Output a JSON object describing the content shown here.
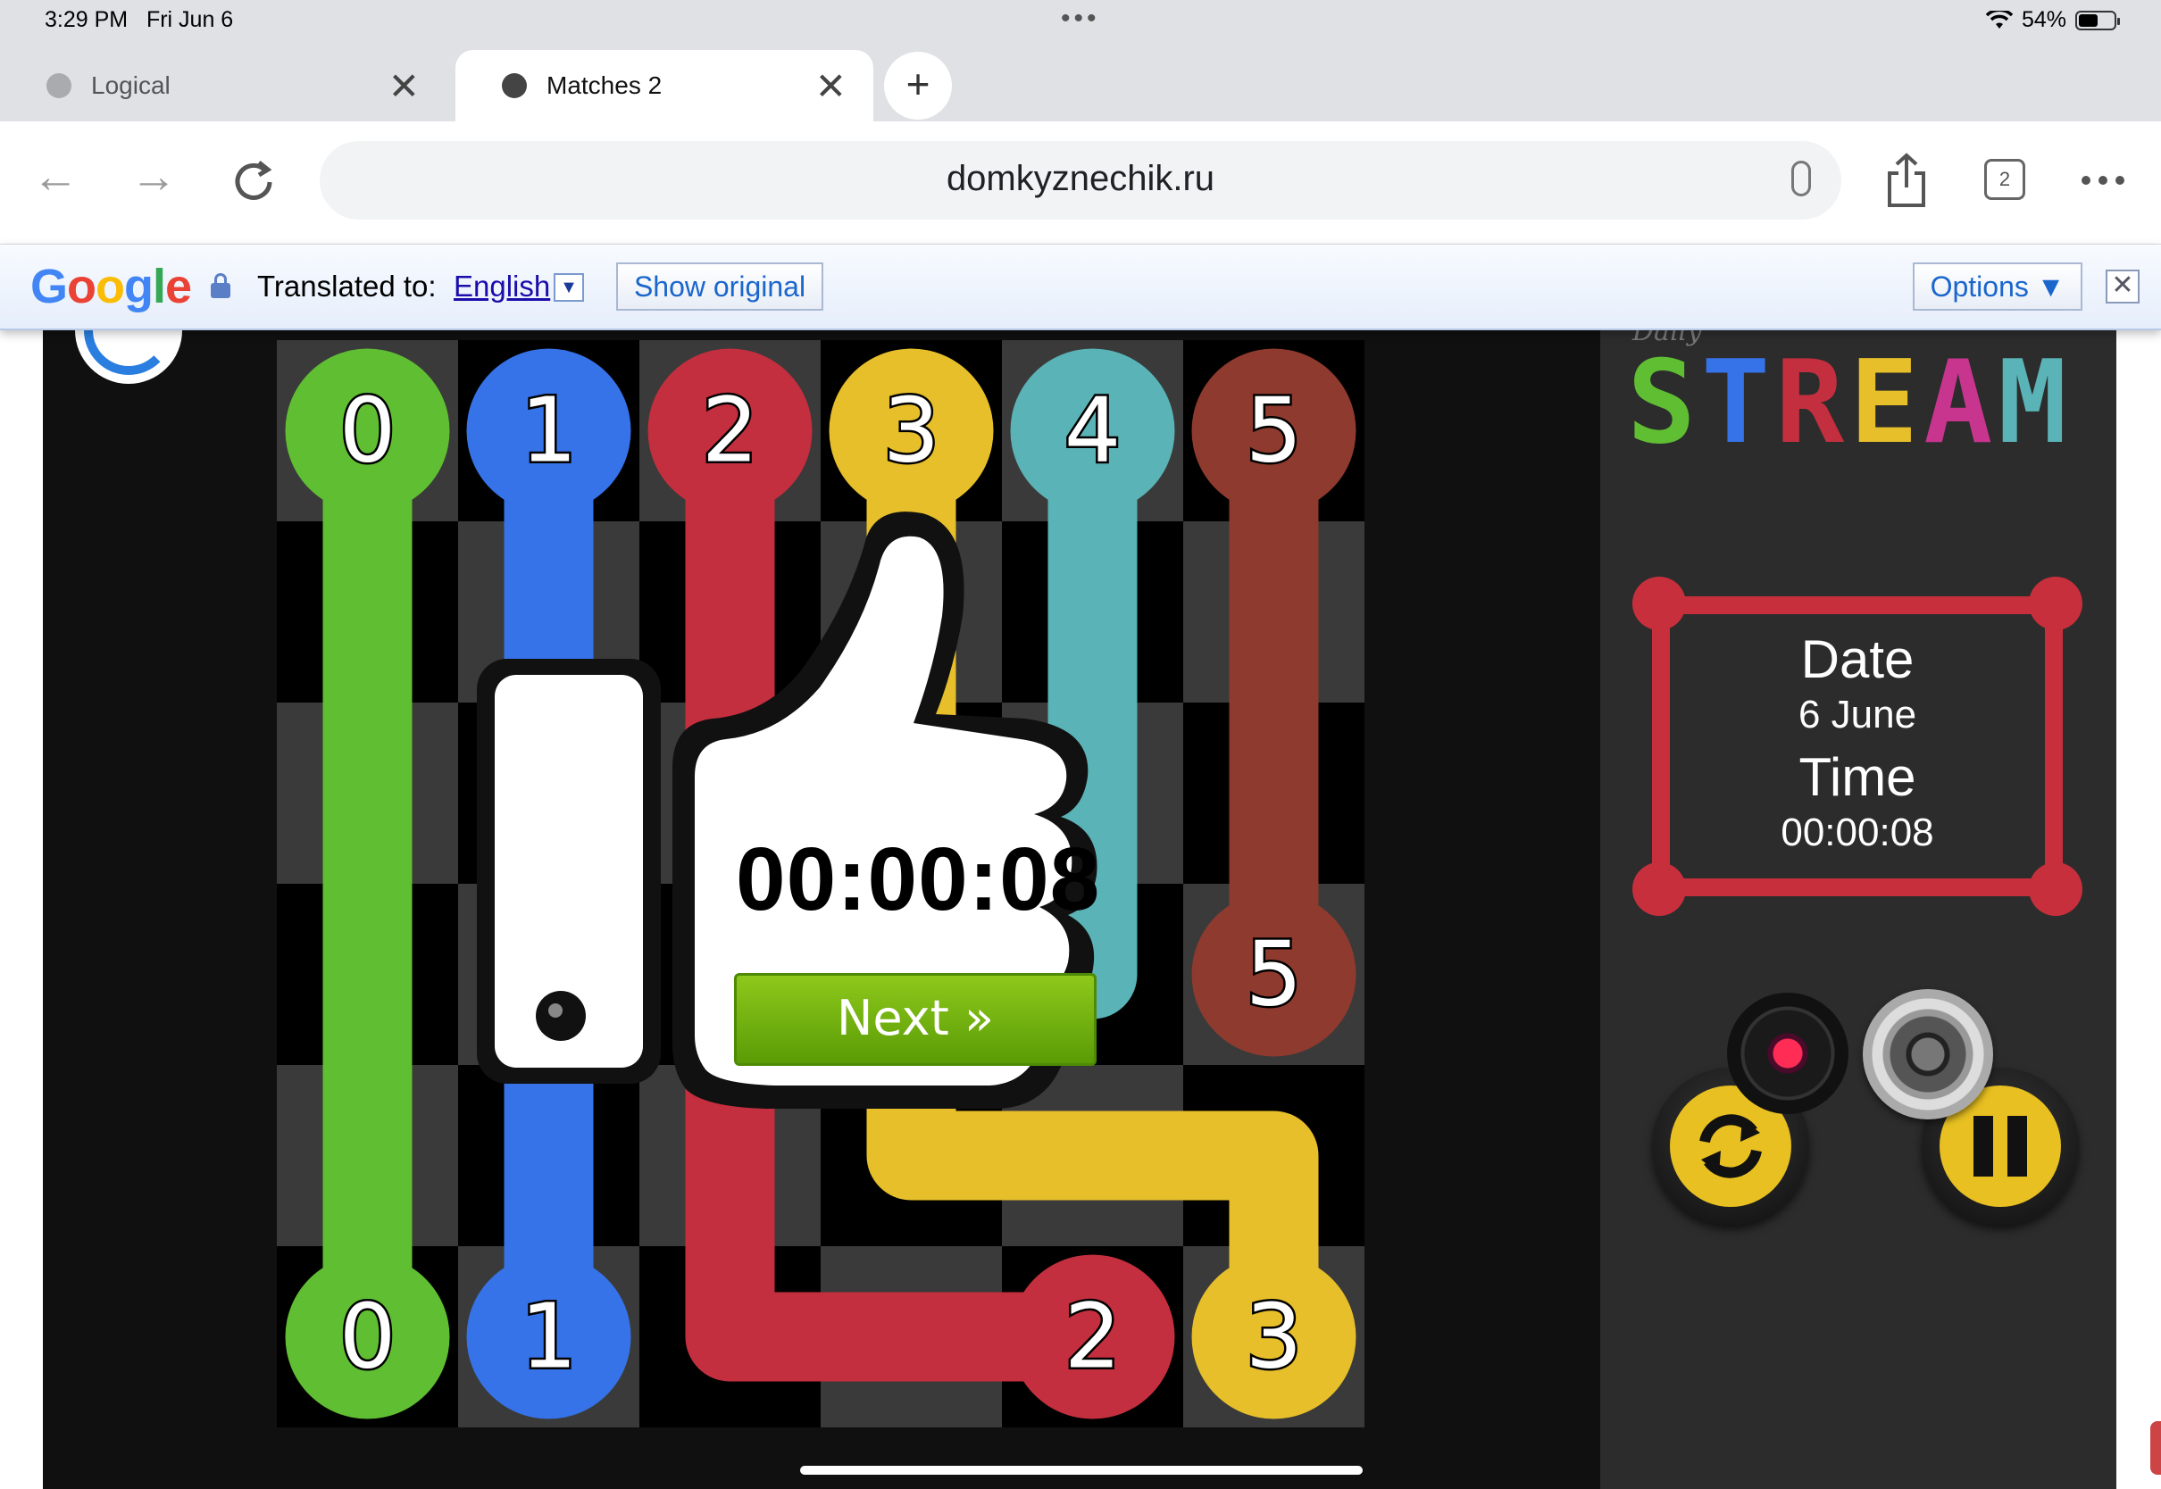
{
  "status_bar": {
    "time": "3:29 PM",
    "date": "Fri Jun 6",
    "more": "•••",
    "battery": "54%",
    "battery_level": 0.54
  },
  "tabs": [
    {
      "title": "Logical",
      "active": false
    },
    {
      "title": "Matches 2",
      "active": true
    }
  ],
  "new_tab_label": "+",
  "toolbar": {
    "url": "domkyznechik.ru",
    "tab_count": "2"
  },
  "translate_bar": {
    "logo": "Google",
    "translated_to_label": "Translated to:",
    "language": "English",
    "show_original": "Show original",
    "options": "Options ▼",
    "close": "✕"
  },
  "board": {
    "colors": {
      "0": "#5fbe32",
      "1": "#3673e8",
      "2": "#c32f3e",
      "3": "#e7bf2a",
      "4": "#5ab3b6",
      "5": "#8e3a2e"
    },
    "endpoints": [
      {
        "label": "0",
        "color_id": "0",
        "col": 0,
        "row": 0
      },
      {
        "label": "1",
        "color_id": "1",
        "col": 1,
        "row": 0
      },
      {
        "label": "2",
        "color_id": "2",
        "col": 2,
        "row": 0
      },
      {
        "label": "3",
        "color_id": "3",
        "col": 3,
        "row": 0
      },
      {
        "label": "4",
        "color_id": "4",
        "col": 4,
        "row": 0
      },
      {
        "label": "5",
        "color_id": "5",
        "col": 5,
        "row": 0
      },
      {
        "label": "5",
        "color_id": "5",
        "col": 5,
        "row": 3
      },
      {
        "label": "0",
        "color_id": "0",
        "col": 0,
        "row": 5
      },
      {
        "label": "1",
        "color_id": "1",
        "col": 1,
        "row": 5
      },
      {
        "label": "2",
        "color_id": "2",
        "col": 4,
        "row": 5
      },
      {
        "label": "3",
        "color_id": "3",
        "col": 5,
        "row": 5
      }
    ]
  },
  "sidebar": {
    "logo_small": "Daily",
    "logo_letters": [
      {
        "ch": "S",
        "color": "#5fbe32"
      },
      {
        "ch": "T",
        "color": "#3673e8"
      },
      {
        "ch": "R",
        "color": "#c32f3e"
      },
      {
        "ch": "E",
        "color": "#e7bf2a"
      },
      {
        "ch": "A",
        "color": "#c8358f"
      },
      {
        "ch": "M",
        "color": "#5ab3b6"
      }
    ],
    "date_label": "Date",
    "date_value": "6 June",
    "time_label": "Time",
    "time_value": "00:00:08"
  },
  "popup": {
    "time": "00:00:08",
    "next_label": "Next »"
  }
}
